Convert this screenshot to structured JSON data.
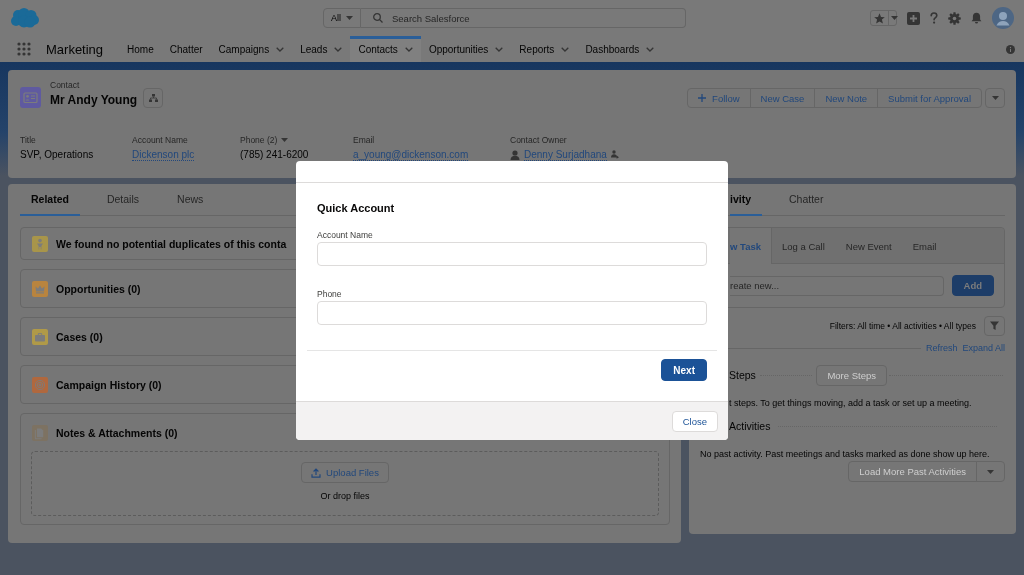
{
  "top_bar": {
    "search_scope": "All",
    "search_placeholder": "Search Salesforce"
  },
  "nav": {
    "app_name": "Marketing",
    "items": [
      {
        "label": "Home",
        "has_menu": false,
        "selected": false
      },
      {
        "label": "Chatter",
        "has_menu": false,
        "selected": false
      },
      {
        "label": "Campaigns",
        "has_menu": true,
        "selected": false
      },
      {
        "label": "Leads",
        "has_menu": true,
        "selected": false
      },
      {
        "label": "Contacts",
        "has_menu": true,
        "selected": true
      },
      {
        "label": "Opportunities",
        "has_menu": true,
        "selected": false
      },
      {
        "label": "Reports",
        "has_menu": true,
        "selected": false
      },
      {
        "label": "Dashboards",
        "has_menu": true,
        "selected": false
      }
    ]
  },
  "record_header": {
    "object_type": "Contact",
    "name": "Mr Andy Young",
    "actions": [
      {
        "label": "Follow",
        "kind": "follow"
      },
      {
        "label": "New Case",
        "kind": "plain"
      },
      {
        "label": "New Note",
        "kind": "plain"
      },
      {
        "label": "Submit for Approval",
        "kind": "plain"
      }
    ],
    "fields": [
      {
        "label": "Title",
        "value": "SVP, Operations",
        "kind": "text"
      },
      {
        "label": "Account Name",
        "value": "Dickenson plc",
        "kind": "link"
      },
      {
        "label": "Phone (2)",
        "value": "(785) 241-6200",
        "kind": "menu"
      },
      {
        "label": "Email",
        "value": "a_young@dickenson.com",
        "kind": "link"
      },
      {
        "label": "Contact Owner",
        "value": "Denny Surjadhana",
        "kind": "user"
      }
    ]
  },
  "left_panel": {
    "tabs": [
      {
        "label": "Related",
        "selected": true
      },
      {
        "label": "Details",
        "selected": false
      },
      {
        "label": "News",
        "selected": false
      }
    ],
    "related_lists": [
      {
        "kind": "duplicates",
        "title": "We found no potential duplicates of this conta",
        "color": "#a8954a"
      },
      {
        "kind": "opportunities",
        "title": "Opportunities (0)",
        "color": "#b8843f"
      },
      {
        "kind": "cases",
        "title": "Cases (0)",
        "color": "#b09a48"
      },
      {
        "kind": "campaign_history",
        "title": "Campaign History (0)",
        "color": "#b0683e"
      },
      {
        "kind": "notes",
        "title": "Notes & Attachments (0)",
        "color": "#7d7262",
        "upload": {
          "button": "Upload Files",
          "hint": "Or drop files"
        }
      }
    ]
  },
  "right_panel": {
    "tabs": [
      {
        "label": "ivity",
        "selected": true
      },
      {
        "label": "Chatter",
        "selected": false
      }
    ],
    "composer": {
      "tabs": [
        {
          "label": "w Task",
          "selected": true
        },
        {
          "label": "Log a Call",
          "selected": false
        },
        {
          "label": "New Event",
          "selected": false
        },
        {
          "label": "Email",
          "selected": false
        }
      ],
      "placeholder": "reate new...",
      "add_button": "Add"
    },
    "filters": "Filters: All time • All activities • All types",
    "links": [
      "Refresh",
      "Expand All"
    ],
    "next_steps": {
      "heading": "Steps",
      "button": {
        "label": "More Steps",
        "disabled": true
      },
      "message": "t steps. To get things moving, add a task or set up a meeting."
    },
    "past_activities": {
      "heading": "Activities",
      "message": "No past activity. Past meetings and tasks marked as done show up here.",
      "button": {
        "label": "Load More Past Activities",
        "disabled": true
      }
    }
  },
  "modal": {
    "title": "Quick Account",
    "fields": [
      {
        "label": "Account Name"
      },
      {
        "label": "Phone"
      }
    ],
    "next_button": "Next",
    "close_button": "Close"
  }
}
